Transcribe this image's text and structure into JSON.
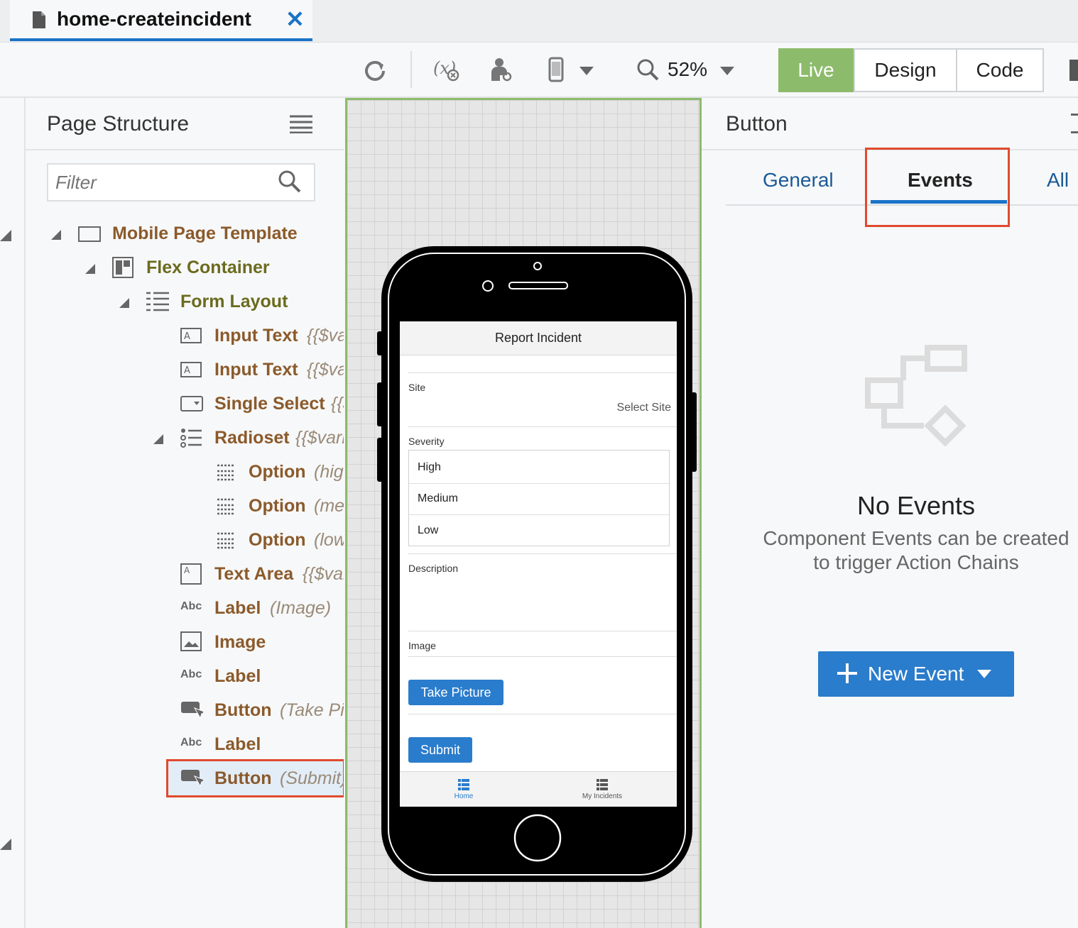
{
  "tab": {
    "title": "home-createincident",
    "close": "✕"
  },
  "toolbar": {
    "zoom": "52%",
    "modes": [
      "Live",
      "Design",
      "Code"
    ]
  },
  "structure": {
    "title": "Page Structure",
    "filter_placeholder": "Filter",
    "nodes": [
      {
        "label": "Mobile Page Template",
        "sub": ""
      },
      {
        "label": "Flex Container",
        "sub": ""
      },
      {
        "label": "Form Layout",
        "sub": ""
      },
      {
        "label": "Input Text",
        "sub": "{{$variables"
      },
      {
        "label": "Input Text",
        "sub": "{{$variables"
      },
      {
        "label": "Single Select",
        "sub": "{{$variables"
      },
      {
        "label": "Radioset",
        "sub": "{{$variables"
      },
      {
        "label": "Option",
        "sub": "(high)"
      },
      {
        "label": "Option",
        "sub": "(medium)"
      },
      {
        "label": "Option",
        "sub": "(low)"
      },
      {
        "label": "Text Area",
        "sub": "{{$variables"
      },
      {
        "label": "Label",
        "sub": "(Image)"
      },
      {
        "label": "Image",
        "sub": ""
      },
      {
        "label": "Label",
        "sub": ""
      },
      {
        "label": "Button",
        "sub": "(Take Picture)"
      },
      {
        "label": "Label",
        "sub": ""
      },
      {
        "label": "Button",
        "sub": "(Submit)"
      }
    ]
  },
  "phone": {
    "header": "Report Incident",
    "site_label": "Site",
    "site_value": "Select Site",
    "severity_label": "Severity",
    "severity_options": [
      "High",
      "Medium",
      "Low"
    ],
    "description_label": "Description",
    "image_label": "Image",
    "take_picture": "Take Picture",
    "submit": "Submit",
    "footer": [
      "Home",
      "My Incidents"
    ]
  },
  "props": {
    "title": "Button",
    "tabs": [
      "General",
      "Events",
      "All"
    ],
    "empty_title": "No Events",
    "empty_desc_1": "Component Events can be created",
    "empty_desc_2": "to trigger Action Chains",
    "new_event": "New Event"
  },
  "colors": {
    "accent": "#1a73c7",
    "live": "#8dbb6c",
    "highlight": "#e04a2f",
    "node_label": "#8b5a2b",
    "olive_label": "#6b6b1f"
  }
}
